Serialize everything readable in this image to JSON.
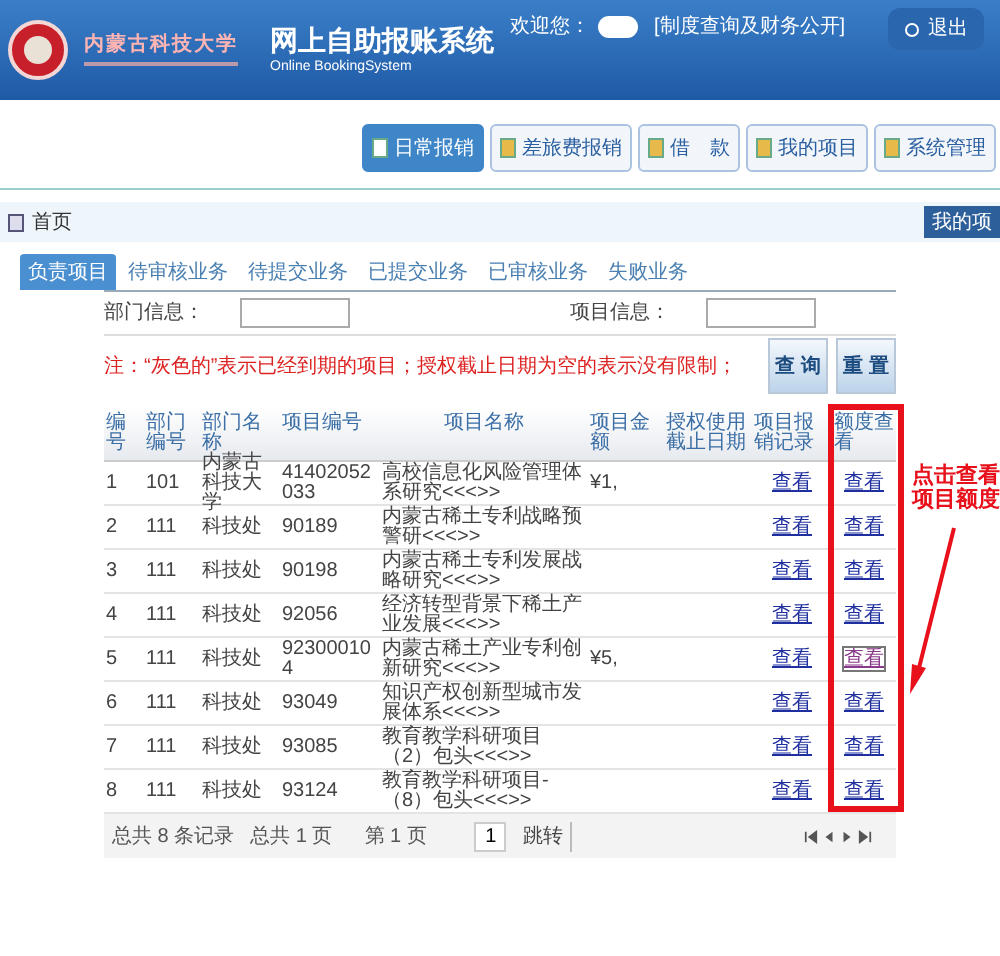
{
  "header": {
    "school_name": "内蒙古科技大学",
    "title": "网上自助报账系统",
    "subtitle": "Online BookingSystem",
    "welcome": "欢迎您：",
    "public_link": "[制度查询及财务公开]",
    "logout": "退出"
  },
  "nav": [
    {
      "label": "日常报销",
      "selected": true
    },
    {
      "label": "差旅费报销",
      "selected": false
    },
    {
      "label": "借　款",
      "selected": false
    },
    {
      "label": "我的项目",
      "selected": false
    },
    {
      "label": "系统管理",
      "selected": false
    }
  ],
  "breadcrumb": {
    "label": "首页",
    "right_button": "我的项"
  },
  "tabs": [
    {
      "label": "负责项目",
      "selected": true
    },
    {
      "label": "待审核业务",
      "selected": false
    },
    {
      "label": "待提交业务",
      "selected": false
    },
    {
      "label": "已提交业务",
      "selected": false
    },
    {
      "label": "已审核业务",
      "selected": false
    },
    {
      "label": "失败业务",
      "selected": false
    }
  ],
  "filters": [
    {
      "label": "部门信息："
    },
    {
      "label": "项目信息："
    }
  ],
  "note": "注：“灰色的”表示已经到期的项目；授权截止日期为空的表示没有限制；",
  "buttons": [
    "查 询",
    "重 置"
  ],
  "table": {
    "columns": [
      "编号",
      "部门编号",
      "部门名称",
      "项目编号",
      "项目名称",
      "项目金额",
      "授权使用截止日期",
      "项目报销记录",
      "额度查看"
    ],
    "rows": [
      {
        "cells": [
          "1",
          "101",
          "内蒙古科技大学",
          "41402052033",
          "高校信息化风险管理体系研究<<<>>",
          "¥1,",
          ""
        ],
        "links": [
          "查看",
          "查看"
        ],
        "focused": false
      },
      {
        "cells": [
          "2",
          "111",
          "科技处",
          "90189",
          "内蒙古稀土专利战略预警研<<<>>",
          "",
          ""
        ],
        "links": [
          "查看",
          "查看"
        ],
        "focused": false
      },
      {
        "cells": [
          "3",
          "111",
          "科技处",
          "90198",
          "内蒙古稀土专利发展战略研究<<<>>",
          "",
          ""
        ],
        "links": [
          "查看",
          "查看"
        ],
        "focused": false
      },
      {
        "cells": [
          "4",
          "111",
          "科技处",
          "92056",
          "经济转型背景下稀土产业发展<<<>>",
          "",
          ""
        ],
        "links": [
          "查看",
          "查看"
        ],
        "focused": false
      },
      {
        "cells": [
          "5",
          "111",
          "科技处",
          "923000104",
          "内蒙古稀土产业专利创新研究<<<>>",
          "¥5,",
          ""
        ],
        "links": [
          "查看",
          "查看"
        ],
        "focused": true
      },
      {
        "cells": [
          "6",
          "111",
          "科技处",
          "93049",
          "知识产权创新型城市发展体系<<<>>",
          "",
          ""
        ],
        "links": [
          "查看",
          "查看"
        ],
        "focused": false
      },
      {
        "cells": [
          "7",
          "111",
          "科技处",
          "93085",
          "教育教学科研项目（2）包头<<<>>",
          "",
          ""
        ],
        "links": [
          "查看",
          "查看"
        ],
        "focused": false
      },
      {
        "cells": [
          "8",
          "111",
          "科技处",
          "93124",
          "教育教学科研项目-（8）包头<<<>>",
          "",
          ""
        ],
        "links": [
          "查看",
          "查看"
        ],
        "focused": false
      }
    ]
  },
  "pager": {
    "total_records": "总共 8 条记录",
    "total_pages": "总共 1 页",
    "current_page": "第 1 页",
    "page_input": "1",
    "jump": "跳转"
  },
  "annotation": "点击查看项目额度"
}
